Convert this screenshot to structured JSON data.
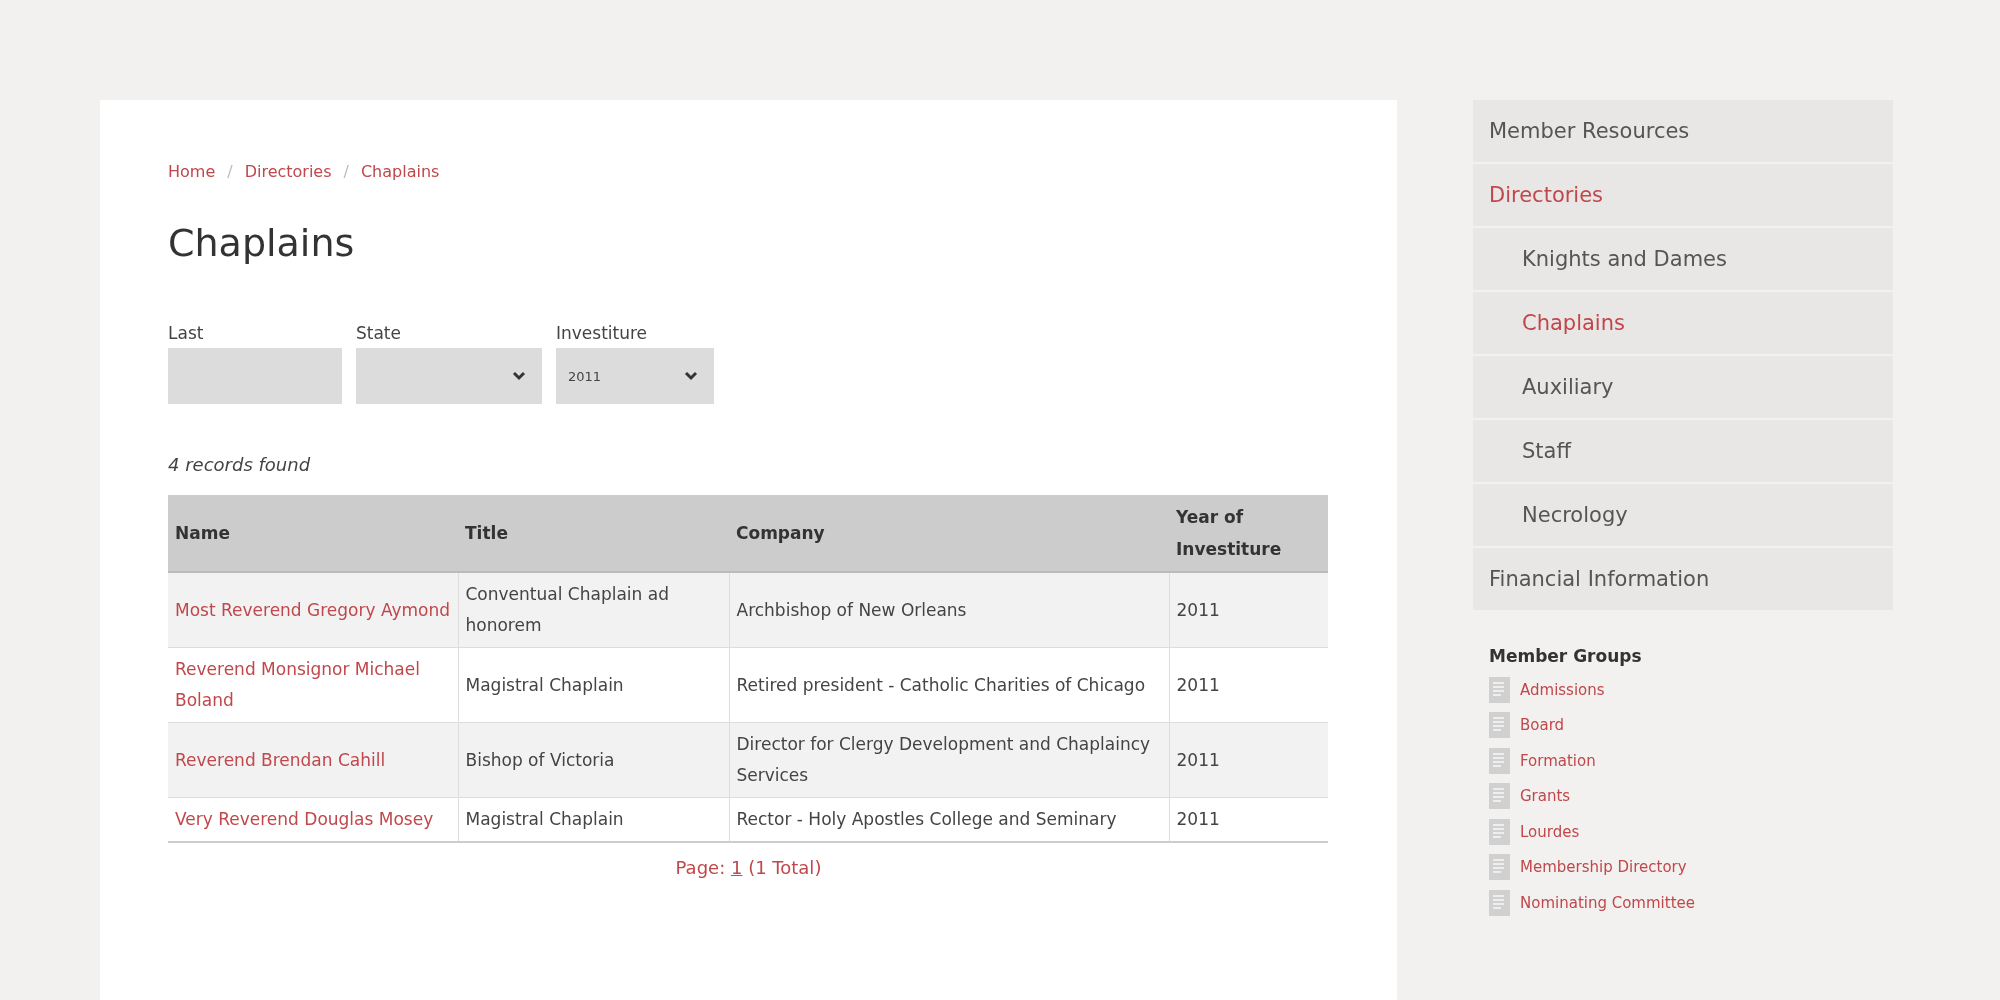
{
  "breadcrumb": [
    {
      "label": "Home"
    },
    {
      "label": "Directories"
    },
    {
      "label": "Chaplains"
    }
  ],
  "breadcrumb_separator": "/",
  "page_title": "Chaplains",
  "filters": [
    {
      "kind": "text",
      "label": "Last"
    },
    {
      "kind": "select",
      "label": "State"
    },
    {
      "kind": "select",
      "label": "Investiture",
      "value": "2011"
    }
  ],
  "records_found": "4 records found",
  "table": {
    "columns": [
      "Name",
      "Title",
      "Company",
      "Year of Investiture"
    ],
    "rows": [
      [
        "Most Reverend Gregory Aymond",
        "Conventual Chaplain ad honorem",
        "Archbishop of New Orleans",
        "2011"
      ],
      [
        "Reverend Monsignor Michael Boland",
        "Magistral Chaplain",
        "Retired president - Catholic Charities of Chicago",
        "2011"
      ],
      [
        "Reverend Brendan Cahill",
        "Bishop of Victoria",
        "Director for Clergy Development and Chaplaincy Services",
        "2011"
      ],
      [
        "Very Reverend Douglas Mosey",
        "Magistral Chaplain",
        "Rector - Holy Apostles College and Seminary",
        "2011"
      ]
    ]
  },
  "pagination": {
    "label": "Page:",
    "page": "1",
    "total": "(1 Total)"
  },
  "sidebar": {
    "items": [
      {
        "label": "Member Resources",
        "selected": false
      },
      {
        "label": "Directories",
        "selected": true,
        "children": [
          {
            "label": "Knights and Dames",
            "selected": false
          },
          {
            "label": "Chaplains",
            "selected": true
          },
          {
            "label": "Auxiliary",
            "selected": false
          },
          {
            "label": "Staff",
            "selected": false
          },
          {
            "label": "Necrology",
            "selected": false
          }
        ]
      },
      {
        "label": "Financial Information",
        "selected": false
      }
    ]
  },
  "member_groups": {
    "title": "Member Groups",
    "items": [
      "Admissions",
      "Board",
      "Formation",
      "Grants",
      "Lourdes",
      "Membership Directory",
      "Nominating Committee"
    ]
  }
}
